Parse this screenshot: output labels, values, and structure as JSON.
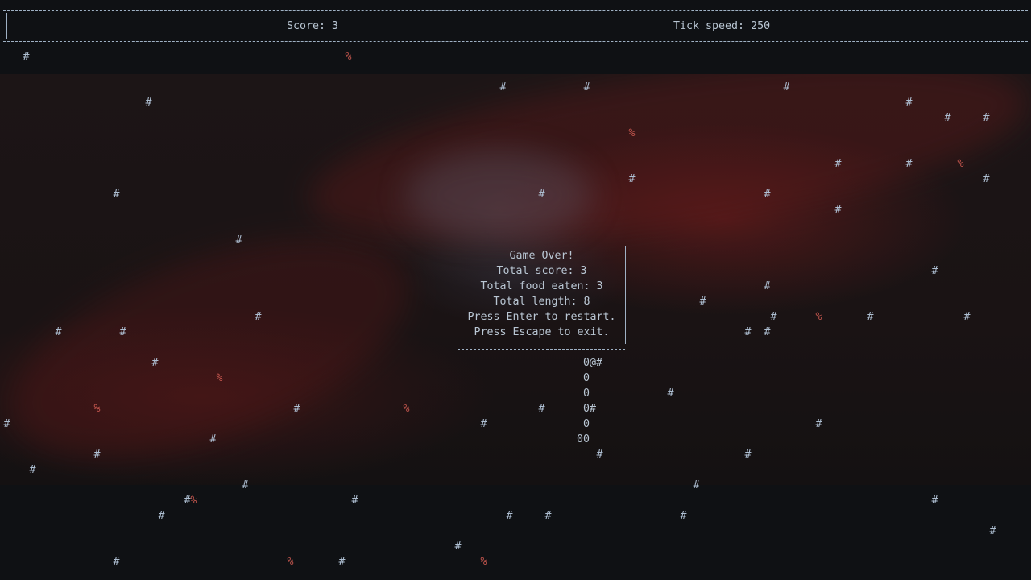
{
  "hud": {
    "score_text": "Score: 3",
    "tick_text": "Tick speed: 250"
  },
  "dialog": {
    "lines": [
      "Game Over!",
      "Total score: 3",
      "Total food eaten: 3",
      "Total length: 8",
      "Press Enter to restart.",
      "Press Escape to exit."
    ]
  },
  "board": {
    "wall_glyph": "#",
    "food_glyph": "%",
    "snake_glyph_body": "0",
    "snake_glyph_head": "@",
    "snake_rows": [
      "0@#",
      "0",
      "0",
      "0#",
      "0",
      "00"
    ]
  },
  "colors": {
    "text": "#b9c6d3",
    "wall": "#aebfd2",
    "food": "#c2554d",
    "background": "#0f1114"
  }
}
